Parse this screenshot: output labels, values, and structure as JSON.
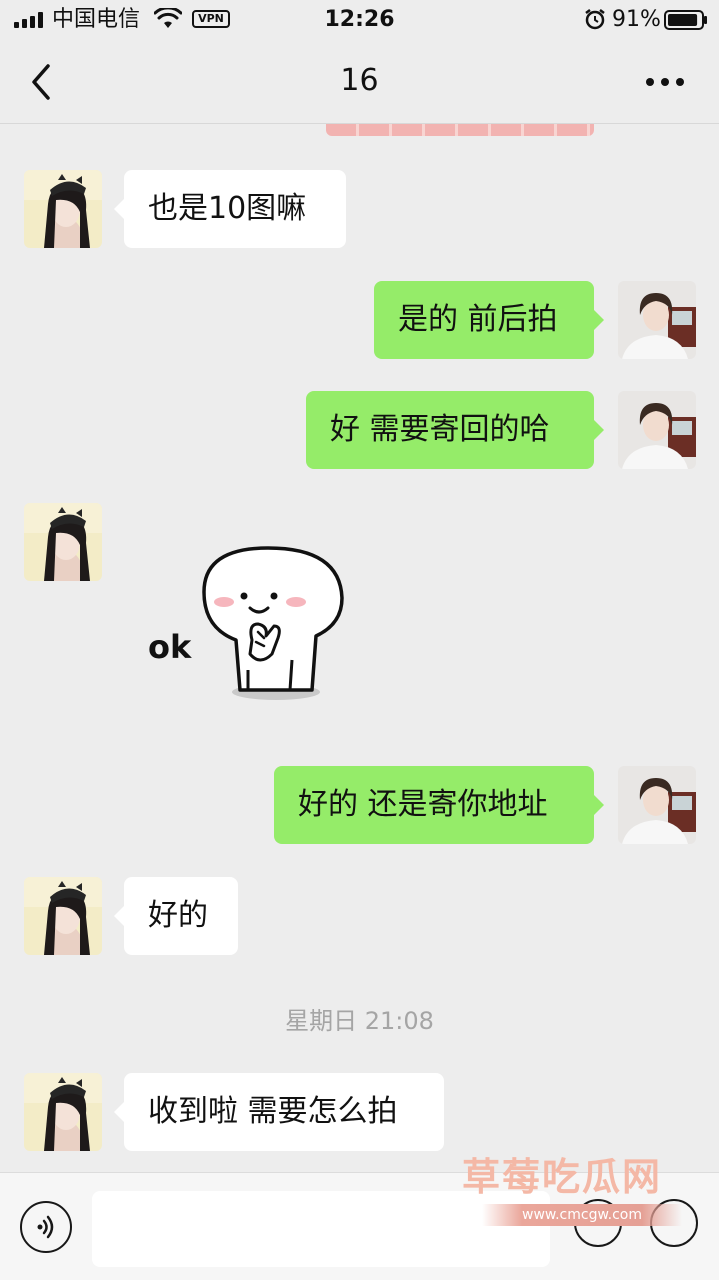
{
  "status_bar": {
    "carrier": "中国电信",
    "vpn": "VPN",
    "time": "12:26",
    "battery_percent": "91%",
    "battery_level": 0.91
  },
  "nav": {
    "title": "16"
  },
  "messages": [
    {
      "side": "in",
      "text": "也是10图嘛"
    },
    {
      "side": "out",
      "text": "是的 前后拍"
    },
    {
      "side": "out",
      "text": "好 需要寄回的哈"
    },
    {
      "side": "in",
      "type": "sticker",
      "sticker_text": "ok"
    },
    {
      "side": "out",
      "text": "好的 还是寄你地址"
    },
    {
      "side": "in",
      "text": "好的"
    },
    {
      "side": "in",
      "text": "收到啦 需要怎么拍"
    }
  ],
  "timestamp": "星期日 21:08",
  "input_bar": {
    "placeholder": ""
  },
  "watermark": {
    "text": "草莓吃瓜网",
    "url": "www.cmcgw.com"
  },
  "colors": {
    "background": "#ededed",
    "outgoing_bubble": "#95ec69",
    "incoming_bubble": "#ffffff"
  }
}
